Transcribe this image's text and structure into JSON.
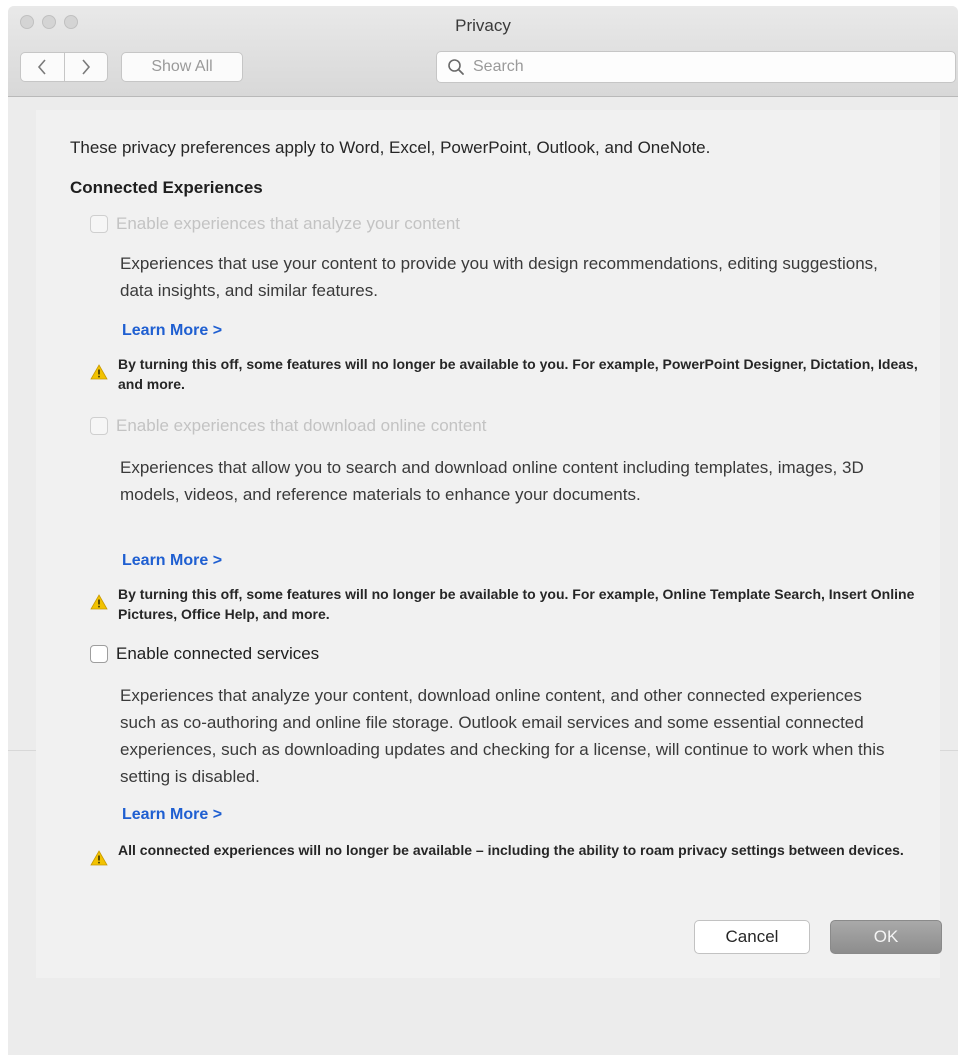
{
  "window": {
    "title": "Privacy"
  },
  "toolbar": {
    "back_icon": "chevron-left-icon",
    "forward_icon": "chevron-right-icon",
    "show_all_label": "Show All",
    "search_placeholder": "Search"
  },
  "content": {
    "intro": "These privacy preferences apply to Word, Excel, PowerPoint, Outlook, and OneNote.",
    "section_title": "Connected Experiences",
    "options": [
      {
        "label": "Enable experiences that analyze your content",
        "checked": false,
        "enabled": false,
        "description": "Experiences that use your content to provide you with design recommendations, editing suggestions, data insights, and similar features.",
        "learn_more": "Learn More >",
        "warning": "By turning this off, some features will no longer be available to you. For example, PowerPoint Designer, Dictation, Ideas, and more."
      },
      {
        "label": "Enable experiences that download online content",
        "checked": false,
        "enabled": false,
        "description": "Experiences that allow you to search and download online content including templates, images, 3D models, videos, and reference materials to enhance your documents.",
        "learn_more": "Learn More >",
        "warning": "By turning this off, some features will no longer be available to you. For example, Online Template Search, Insert Online Pictures, Office Help, and more."
      },
      {
        "label": "Enable connected services",
        "checked": false,
        "enabled": true,
        "description": "Experiences that analyze your content, download online content, and other connected experiences such as co-authoring and online file storage. Outlook email services and some essential connected experiences, such as downloading updates and checking for a license, will continue to work when this setting is disabled.",
        "learn_more": "Learn More >",
        "warning": "All connected experiences will no longer be available – including the ability to roam privacy settings between devices."
      }
    ]
  },
  "buttons": {
    "cancel_label": "Cancel",
    "ok_label": "OK"
  },
  "colors": {
    "link": "#1f5fd1",
    "warning_icon": "#f2c200",
    "panel_bg": "#f1f1f1",
    "window_bg": "#ececec"
  }
}
